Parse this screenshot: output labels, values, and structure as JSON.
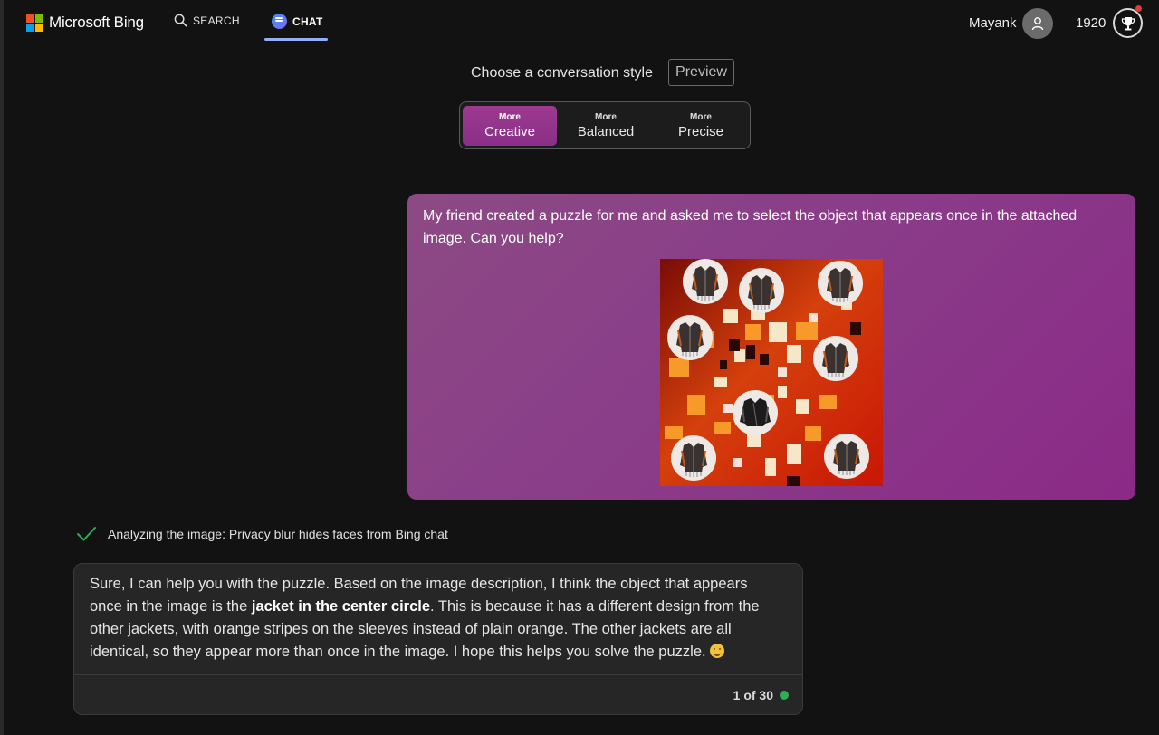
{
  "header": {
    "brand": "Microsoft Bing",
    "nav": [
      {
        "label": "SEARCH",
        "icon": "search-icon"
      },
      {
        "label": "CHAT",
        "icon": "chat-icon",
        "active": true
      }
    ],
    "user_name": "Mayank",
    "reward_points": "1920"
  },
  "conversation_style": {
    "label": "Choose a conversation style",
    "badge": "Preview",
    "options": [
      {
        "prefix": "More",
        "label": "Creative",
        "selected": true
      },
      {
        "prefix": "More",
        "label": "Balanced",
        "selected": false
      },
      {
        "prefix": "More",
        "label": "Precise",
        "selected": false
      }
    ]
  },
  "user_message": {
    "text": "My friend created a puzzle for me and asked me to select the object that appears once in the attached image. Can you help?"
  },
  "status": {
    "text": "Analyzing the image: Privacy blur hides faces from Bing chat"
  },
  "bot_message": {
    "text_before": "Sure, I can help you with the puzzle. Based on the image description, I think the object that appears once in the image is the ",
    "bold": "jacket in the center circle",
    "text_after": ". This is because it has a different design from the other jackets, with orange stripes on the sleeves instead of plain orange. The other jackets are all identical, so they appear more than once in the image. I hope this helps you solve the puzzle. ",
    "counter": "1 of 30"
  },
  "colors": {
    "accent_creative": "#9d3a8f",
    "user_bubble": "#8a3d89",
    "active_tab_underline": "#8fb0f5",
    "status_check": "#2fae55"
  }
}
